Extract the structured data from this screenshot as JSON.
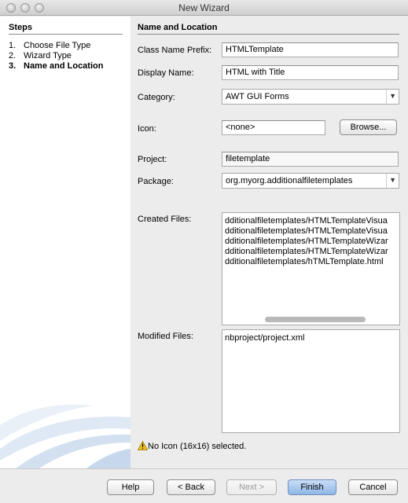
{
  "window": {
    "title": "New Wizard"
  },
  "steps": {
    "title": "Steps",
    "items": [
      {
        "num": "1.",
        "label": "Choose File Type"
      },
      {
        "num": "2.",
        "label": "Wizard Type"
      },
      {
        "num": "3.",
        "label": "Name and Location"
      }
    ]
  },
  "main": {
    "title": "Name and Location",
    "class_name_prefix": {
      "label": "Class Name Prefix:",
      "value": "HTMLTemplate"
    },
    "display_name": {
      "label": "Display Name:",
      "value": "HTML with Title"
    },
    "category": {
      "label": "Category:",
      "value": "AWT GUI Forms"
    },
    "icon": {
      "label": "Icon:",
      "value": "<none>",
      "browse": "Browse..."
    },
    "project": {
      "label": "Project:",
      "value": "filetemplate"
    },
    "package": {
      "label": "Package:",
      "value": "org.myorg.additionalfiletemplates"
    },
    "created_files": {
      "label": "Created Files:",
      "lines": [
        "dditionalfiletemplates/HTMLTemplateVisua",
        "dditionalfiletemplates/HTMLTemplateVisua",
        "dditionalfiletemplates/HTMLTemplateWizar",
        "dditionalfiletemplates/HTMLTemplateWizar",
        "dditionalfiletemplates/hTMLTemplate.html"
      ]
    },
    "modified_files": {
      "label": "Modified Files:",
      "lines": [
        "nbproject/project.xml"
      ]
    },
    "warning": "No Icon (16x16) selected."
  },
  "footer": {
    "help": "Help",
    "back": "< Back",
    "next": "Next >",
    "finish": "Finish",
    "cancel": "Cancel"
  },
  "colors": {
    "warning": "#f2c01e",
    "default_button": "#8fb6e6"
  }
}
